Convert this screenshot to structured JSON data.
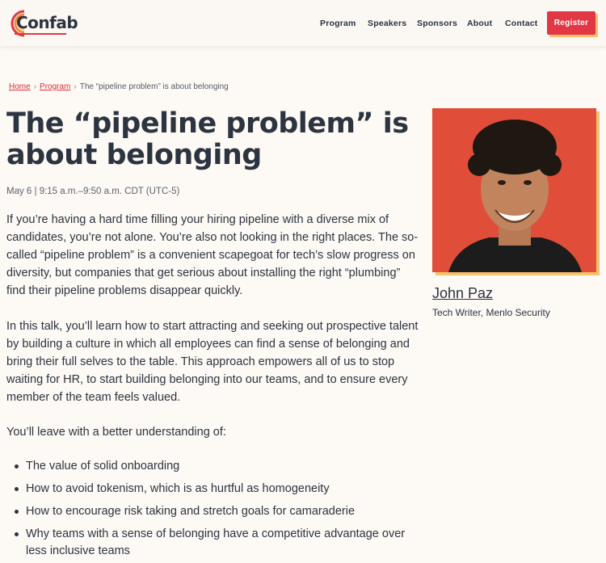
{
  "header": {
    "logo_text": "Confab",
    "nav": [
      "Program",
      "Speakers",
      "Sponsors",
      "About",
      "Contact"
    ],
    "register_label": "Register"
  },
  "breadcrumb": {
    "home": "Home",
    "program": "Program",
    "current": "The “pipeline problem” is about belonging"
  },
  "session": {
    "title_line1": "The “pipeline problem” is",
    "title_line2": "about belonging",
    "meta": "May 6 | 9:15 a.m.–9:50 a.m. CDT (UTC-5)",
    "para1": "If you’re having a hard time filling your hiring pipeline with a diverse mix of candidates, you’re not alone. You’re also not looking in the right places. The so-called “pipeline problem” is a convenient scapegoat for tech’s slow progress on diversity, but companies that get serious about installing the right “plumbing” find their pipeline problems disappear quickly.",
    "para2": "In this talk, you’ll learn how to start attracting and seeking out prospective talent by building a culture in which all employees can find a sense of belonging and bring their full selves to the table. This approach empowers all of us to stop waiting for HR, to start building belonging into our teams, and to ensure every member of the team feels valued.",
    "para3": "You’ll leave with a better understanding of:",
    "bullets": [
      "The value of solid onboarding",
      "How to avoid tokenism, which is as hurtful as homogeneity",
      "How to encourage risk taking and stretch goals for camaraderie",
      "Why teams with a sense of belonging have a competitive advantage over less inclusive teams"
    ]
  },
  "speaker": {
    "name": "John Paz",
    "role": "Tech Writer, Menlo Security"
  },
  "colors": {
    "accent_red": "#e23744",
    "accent_yellow": "#f5c26b",
    "text_dark": "#2b3440",
    "background": "#fdf9f4"
  }
}
